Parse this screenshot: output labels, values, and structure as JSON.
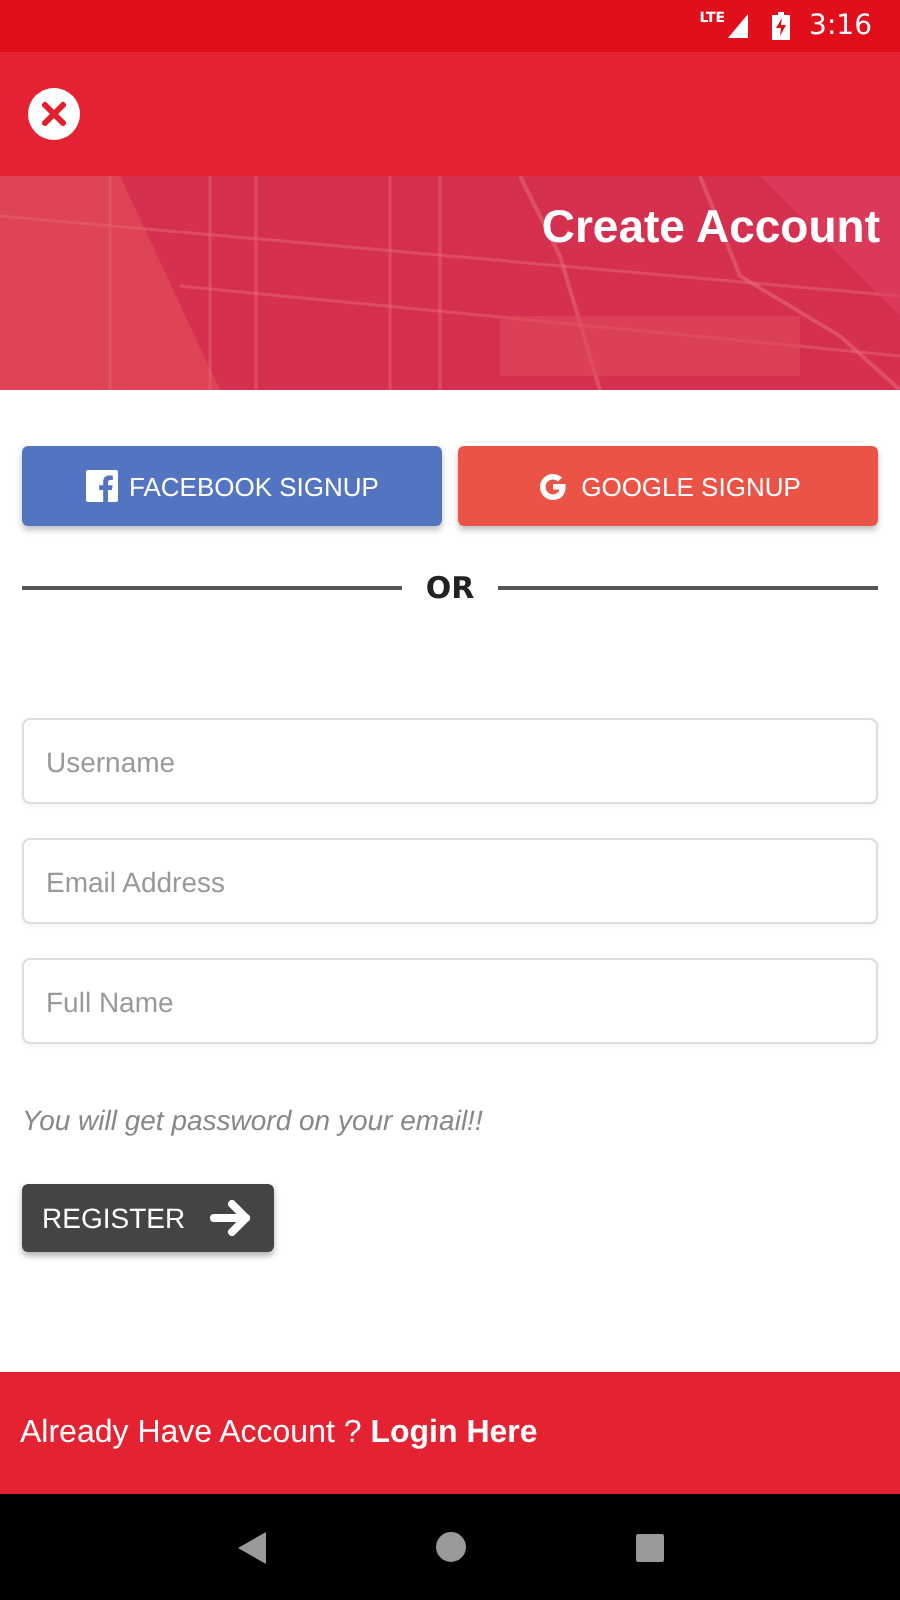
{
  "status_bar": {
    "time": "3:16",
    "network": "LTE"
  },
  "header": {
    "title": "Create Account"
  },
  "social_buttons": [
    {
      "kind": "facebook",
      "label": "FACEBOOK SIGNUP"
    },
    {
      "kind": "google",
      "label": "GOOGLE SIGNUP"
    }
  ],
  "divider": {
    "label": "OR"
  },
  "fields": [
    {
      "placeholder": "Username"
    },
    {
      "placeholder": "Email Address"
    },
    {
      "placeholder": "Full Name"
    }
  ],
  "hint": "You will get password on your email!!",
  "register_button": {
    "label": "REGISTER"
  },
  "footer": {
    "text": "Already Have Account ?",
    "link": "Login Here"
  }
}
